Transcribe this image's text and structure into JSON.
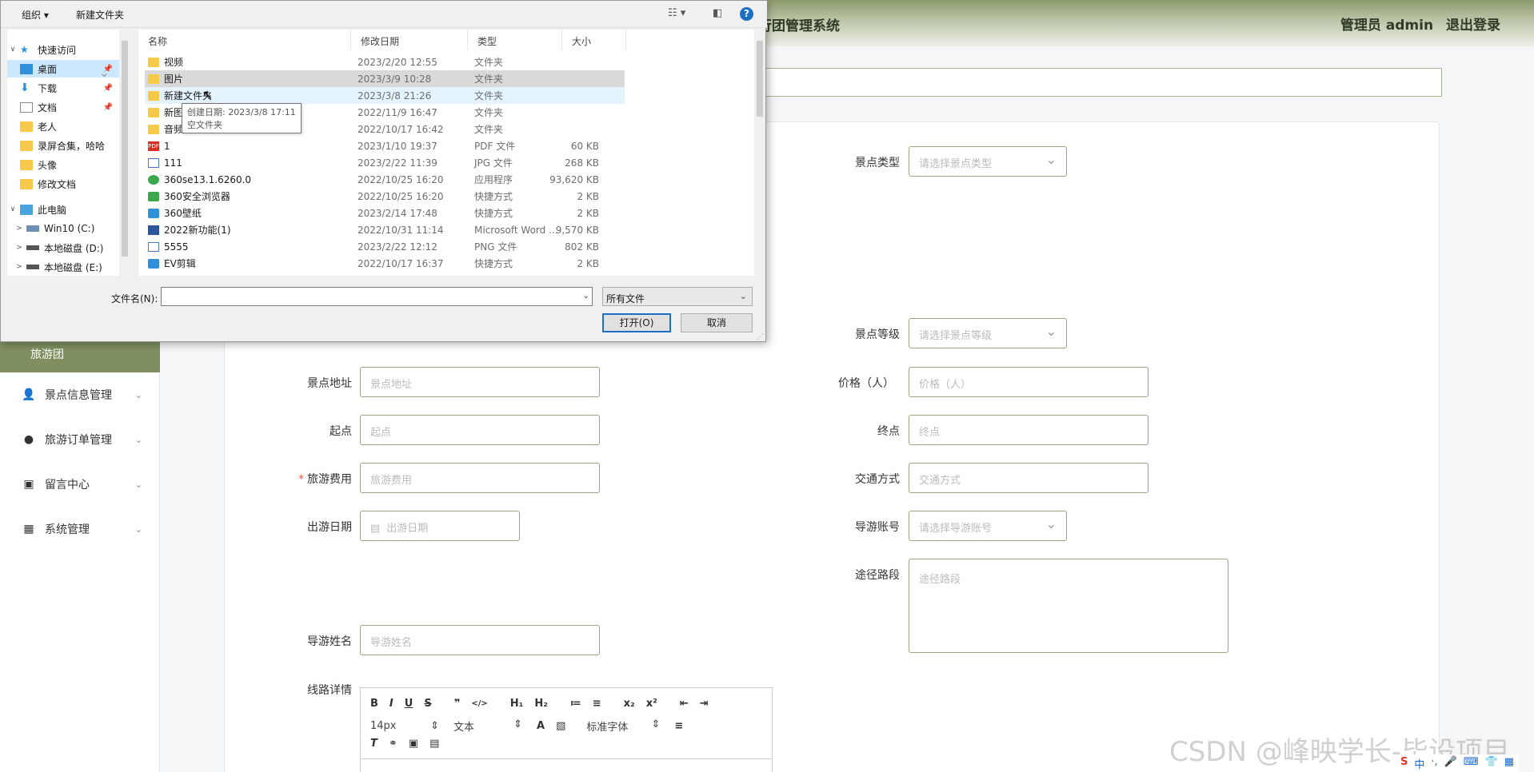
{
  "header": {
    "system_title": "行团管理系统",
    "user": "管理员 admin",
    "logout": "退出登录"
  },
  "sidebar": {
    "active": "旅游团",
    "items": [
      {
        "label": "景点信息管理",
        "icon": "user-icon"
      },
      {
        "label": "旅游订单管理",
        "icon": "pin-icon"
      },
      {
        "label": "留言中心",
        "icon": "clipboard-icon"
      },
      {
        "label": "系统管理",
        "icon": "grid-icon"
      }
    ]
  },
  "form": {
    "scenic_type": {
      "label": "景点类型",
      "placeholder": "请选择景点类型"
    },
    "scenic_level": {
      "label": "景点等级",
      "placeholder": "请选择景点等级"
    },
    "address": {
      "label": "景点地址",
      "placeholder": "景点地址"
    },
    "price": {
      "label": "价格（人）",
      "placeholder": "价格（人）"
    },
    "start": {
      "label": "起点",
      "placeholder": "起点"
    },
    "end": {
      "label": "终点",
      "placeholder": "终点"
    },
    "fee": {
      "label": "旅游费用",
      "placeholder": "旅游费用",
      "required_mark": "*"
    },
    "transport": {
      "label": "交通方式",
      "placeholder": "交通方式"
    },
    "date": {
      "label": "出游日期",
      "placeholder": "出游日期"
    },
    "guide_account": {
      "label": "导游账号",
      "placeholder": "请选择导游账号"
    },
    "route": {
      "label": "途径路段",
      "placeholder": "途径路段"
    },
    "guide_name": {
      "label": "导游姓名",
      "placeholder": "导游姓名"
    },
    "route_detail": {
      "label": "线路详情"
    }
  },
  "editor": {
    "row1": [
      "B",
      "I",
      "U",
      "S",
      "❞",
      "</>",
      "H₁",
      "H₂",
      "≔",
      "≡",
      "x₂",
      "x²",
      "⇤",
      "⇥"
    ],
    "font_size": "14px",
    "text_style": "文本",
    "font_family": "标准字体"
  },
  "watermark": "CSDN @峰映学长-毕设项目",
  "tray": [
    "S",
    "中",
    "·,",
    "🎤",
    "⌨",
    "👕",
    "▦"
  ],
  "dialog": {
    "toolbar": {
      "organize": "组织 ▾",
      "new_folder": "新建文件夹",
      "help": "?"
    },
    "nav": [
      {
        "label": "快速访问",
        "level": 0,
        "twisty": "∨",
        "type": "star"
      },
      {
        "label": "桌面",
        "level": 1,
        "type": "desktop",
        "pinned": true,
        "selected": true
      },
      {
        "label": "下载",
        "level": 1,
        "type": "download",
        "pinned": true
      },
      {
        "label": "文档",
        "level": 1,
        "type": "doc",
        "pinned": true
      },
      {
        "label": "老人",
        "level": 1,
        "type": "folder"
      },
      {
        "label": "录屏合集，哈哈",
        "level": 1,
        "type": "folder"
      },
      {
        "label": "头像",
        "level": 1,
        "type": "folder"
      },
      {
        "label": "修改文档",
        "level": 1,
        "type": "folder"
      },
      {
        "label": "此电脑",
        "level": 0,
        "twisty": "∨",
        "type": "pc"
      },
      {
        "label": "Win10 (C:)",
        "level": 1,
        "twisty": ">",
        "type": "drive"
      },
      {
        "label": "本地磁盘 (D:)",
        "level": 1,
        "twisty": ">",
        "type": "drive"
      },
      {
        "label": "本地磁盘 (E:)",
        "level": 1,
        "twisty": ">",
        "type": "drive"
      }
    ],
    "columns": [
      "名称",
      "修改日期",
      "类型",
      "大小"
    ],
    "files": [
      {
        "name": "视频",
        "date": "2023/2/20 12:55",
        "type": "文件夹",
        "size": "",
        "icon": "folder"
      },
      {
        "name": "图片",
        "date": "2023/3/9 10:28",
        "type": "文件夹",
        "size": "",
        "icon": "folder",
        "state": "selected"
      },
      {
        "name": "新建文件夹",
        "date": "2023/3/8 21:26",
        "type": "文件夹",
        "size": "",
        "icon": "folder",
        "state": "hover"
      },
      {
        "name": "新图片",
        "date": "2022/11/9 16:47",
        "type": "文件夹",
        "size": "",
        "icon": "folder"
      },
      {
        "name": "音频",
        "date": "2022/10/17 16:42",
        "type": "文件夹",
        "size": "",
        "icon": "folder"
      },
      {
        "name": "1",
        "date": "2023/1/10 19:37",
        "type": "PDF 文件",
        "size": "60 KB",
        "icon": "pdf"
      },
      {
        "name": "111",
        "date": "2023/2/22 11:39",
        "type": "JPG 文件",
        "size": "268 KB",
        "icon": "img"
      },
      {
        "name": "360se13.1.6260.0",
        "date": "2022/10/25 16:20",
        "type": "应用程序",
        "size": "93,620 KB",
        "icon": "app"
      },
      {
        "name": "360安全浏览器",
        "date": "2022/10/25 16:20",
        "type": "快捷方式",
        "size": "2 KB",
        "icon": "lnk"
      },
      {
        "name": "360壁纸",
        "date": "2023/2/14 17:48",
        "type": "快捷方式",
        "size": "2 KB",
        "icon": "lnk"
      },
      {
        "name": "2022新功能(1)",
        "date": "2022/10/31 11:14",
        "type": "Microsoft Word ...",
        "size": "9,570 KB",
        "icon": "doc"
      },
      {
        "name": "5555",
        "date": "2023/2/22 12:12",
        "type": "PNG 文件",
        "size": "802 KB",
        "icon": "img"
      },
      {
        "name": "EV剪辑",
        "date": "2022/10/17 16:37",
        "type": "快捷方式",
        "size": "2 KB",
        "icon": "lnk"
      }
    ],
    "tooltip": {
      "line1": "创建日期: 2023/3/8 17:11",
      "line2": "空文件夹"
    },
    "filename_label": "文件名(N):",
    "filename_value": "",
    "filetype": "所有文件",
    "open_button": "打开(O)",
    "cancel_button": "取消"
  }
}
